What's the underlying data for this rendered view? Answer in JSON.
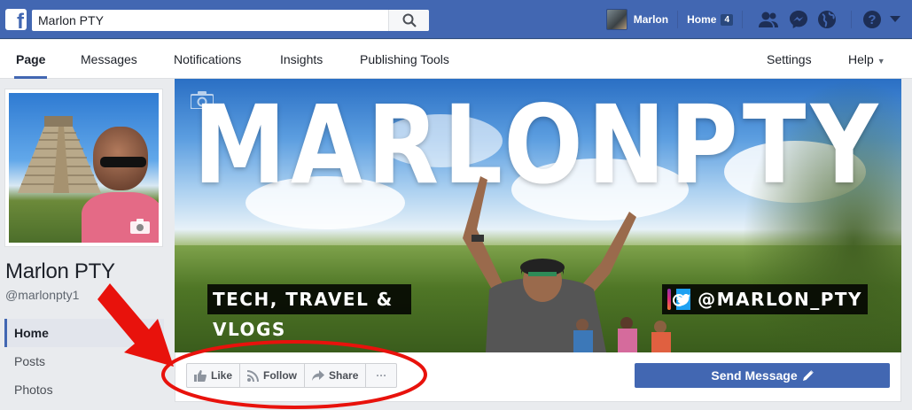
{
  "topbar": {
    "logo": "f",
    "search": {
      "value": "Marlon PTY",
      "icon": "search-icon"
    },
    "profile_name": "Marlon",
    "home_label": "Home",
    "home_count": "4",
    "icons": [
      "friends-icon",
      "messenger-icon",
      "globe-icon",
      "help-icon",
      "caret-down-icon"
    ]
  },
  "tabs": {
    "page": "Page",
    "messages": "Messages",
    "notifications": "Notifications",
    "insights": "Insights",
    "publishing_tools": "Publishing Tools",
    "settings": "Settings",
    "help": "Help"
  },
  "profile": {
    "name": "Marlon PTY",
    "handle": "@marlonpty1"
  },
  "leftnav": {
    "items": [
      {
        "label": "Home",
        "active": true
      },
      {
        "label": "Posts",
        "active": false
      },
      {
        "label": "Photos",
        "active": false
      }
    ]
  },
  "cover": {
    "title": "MARLONPTY",
    "tagline": "TECH, TRAVEL & VLOGS",
    "social_handle": "@MARLON_PTY"
  },
  "actions": {
    "like": "Like",
    "follow": "Follow",
    "share": "Share",
    "more": "···",
    "send_message": "Send Message"
  },
  "colors": {
    "brand_blue": "#4267b2",
    "annotation_red": "#e8120c"
  }
}
